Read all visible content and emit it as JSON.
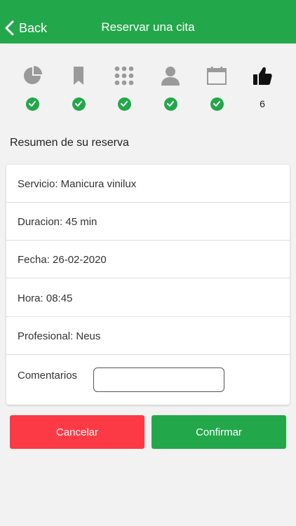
{
  "header": {
    "back_label": "Back",
    "title": "Reservar una cita"
  },
  "steps": [
    {
      "icon": "pie-chart-icon",
      "status": "done"
    },
    {
      "icon": "bookmark-icon",
      "status": "done"
    },
    {
      "icon": "grid-icon",
      "status": "done"
    },
    {
      "icon": "user-icon",
      "status": "done"
    },
    {
      "icon": "calendar-icon",
      "status": "done"
    },
    {
      "icon": "thumbs-up-icon",
      "status": "current",
      "number": "6"
    }
  ],
  "summary": {
    "title": "Resumen de su reserva",
    "service": "Servicio: Manicura vinilux",
    "duration": "Duracion: 45 min",
    "date": "Fecha: 26-02-2020",
    "time": "Hora: 08:45",
    "professional": "Profesional: Neus",
    "comments_label": "Comentarios",
    "comments_value": ""
  },
  "actions": {
    "cancel_label": "Cancelar",
    "confirm_label": "Confirmar"
  },
  "colors": {
    "brand_green": "#22a84a",
    "cancel_red": "#fc3a45",
    "icon_gray": "#9a9a9a"
  }
}
